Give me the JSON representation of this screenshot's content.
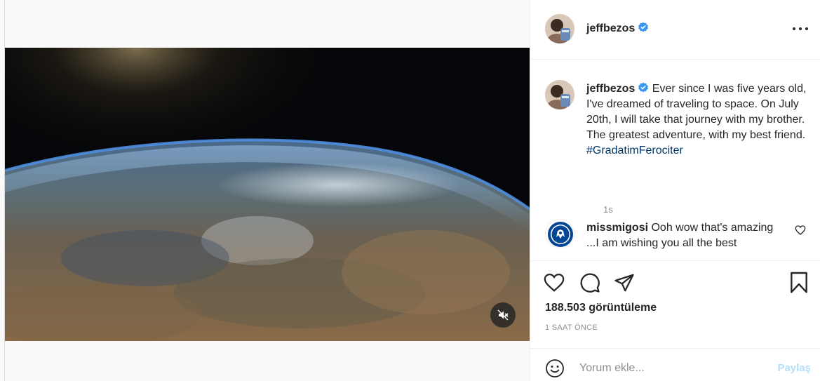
{
  "post": {
    "author": "jeffbezos",
    "verified": true
  },
  "caption": {
    "username": "jeffbezos",
    "text": "Ever since I was five years old, I've dreamed of traveling to space. On July 20th, I will take that journey with my brother. The greatest adventure, with my best friend.",
    "hashtag": "#GradatimFerociter",
    "time": "1s"
  },
  "comments": [
    {
      "username": "missmigosi",
      "text": "Ooh wow that's amazing ...I am wishing you all the best",
      "avatar_icon": "chelsea-fc-crest-icon"
    }
  ],
  "actions": {
    "views": "188.503 görüntüleme",
    "posted_ago": "1 SAAT ÖNCE"
  },
  "add_comment": {
    "placeholder": "Yorum ekle...",
    "share_label": "Paylaş"
  },
  "colors": {
    "verified_blue": "#3897f0",
    "hashtag": "#00376b",
    "share_disabled": "#b2dffc",
    "muted_text": "#8e8e8e"
  }
}
